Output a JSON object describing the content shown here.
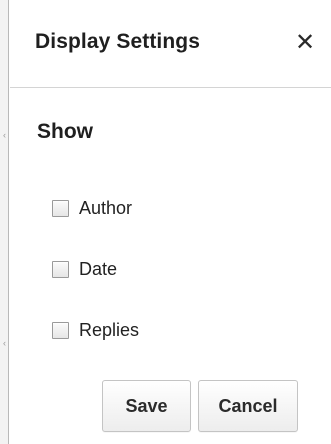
{
  "dialog": {
    "title": "Display Settings",
    "close_glyph": "✕",
    "section_title": "Show",
    "options": [
      {
        "label": "Author",
        "checked": false
      },
      {
        "label": "Date",
        "checked": false
      },
      {
        "label": "Replies",
        "checked": false
      }
    ],
    "save_label": "Save",
    "cancel_label": "Cancel"
  },
  "colors": {
    "text": "#222222",
    "border": "#c4c4c4",
    "edge": "#f3f3f3"
  },
  "icons": {
    "close": "close-icon"
  }
}
